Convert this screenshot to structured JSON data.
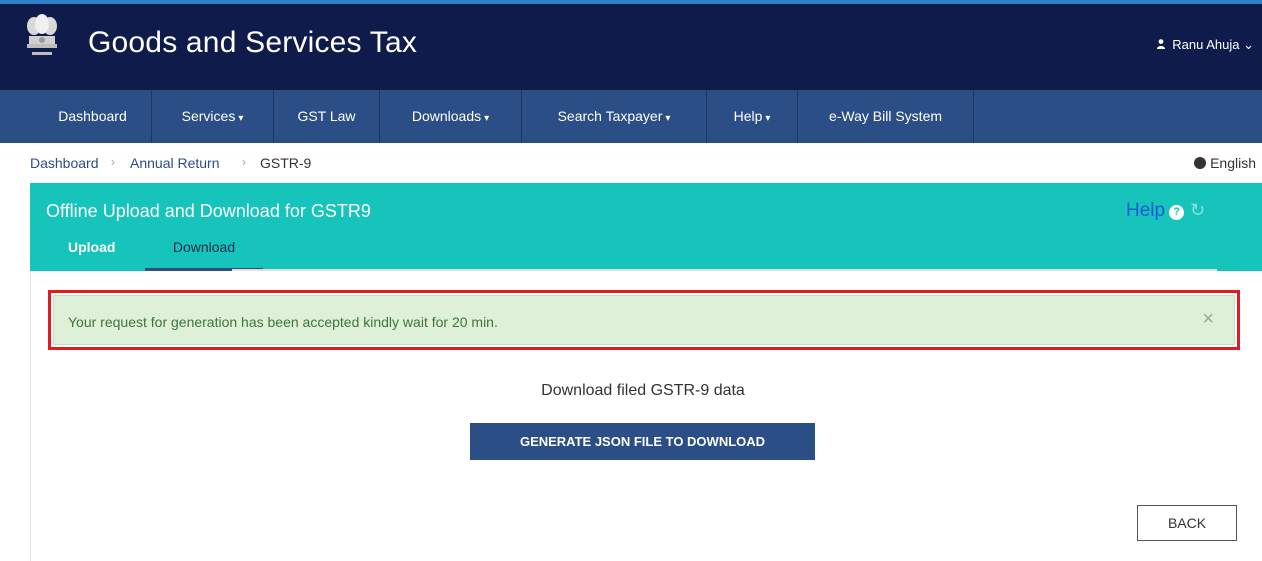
{
  "header": {
    "site_title": "Goods and Services Tax",
    "user_name": "Ranu Ahuja",
    "user_caret": "⌄"
  },
  "nav": {
    "items": [
      {
        "label": "Dashboard",
        "has_dropdown": false
      },
      {
        "label": "Services",
        "has_dropdown": true
      },
      {
        "label": "GST Law",
        "has_dropdown": false
      },
      {
        "label": "Downloads",
        "has_dropdown": true
      },
      {
        "label": "Search Taxpayer",
        "has_dropdown": true
      },
      {
        "label": "Help",
        "has_dropdown": true
      },
      {
        "label": "e-Way Bill System",
        "has_dropdown": false
      }
    ],
    "caret": "▾"
  },
  "breadcrumb": {
    "items": [
      "Dashboard",
      "Annual Return",
      "GSTR-9"
    ],
    "separator": "›"
  },
  "language": "English",
  "panel": {
    "title": "Offline Upload and Download for GSTR9",
    "help_label": "Help",
    "tabs": [
      {
        "label": "Upload",
        "active": false
      },
      {
        "label": "Download",
        "active": true
      }
    ]
  },
  "alert": {
    "message": "Your request for generation has been accepted kindly wait for 20 min.",
    "close": "×"
  },
  "download": {
    "title": "Download filed GSTR-9 data",
    "generate_button": "GENERATE JSON FILE TO DOWNLOAD",
    "back_button": "BACK"
  },
  "colors": {
    "header_bg": "#0f1c4b",
    "nav_bg": "#2c4e86",
    "panel_bg": "#17c4bb",
    "alert_bg": "#dff0d8",
    "alert_text": "#3c763d",
    "highlight_border": "#e01b22",
    "link": "#1d5bd8"
  },
  "icons": {
    "emblem": "national-emblem-icon",
    "user": "person-icon",
    "globe": "globe-icon",
    "help": "question-circle-icon",
    "refresh": "refresh-icon",
    "close": "close-icon"
  }
}
